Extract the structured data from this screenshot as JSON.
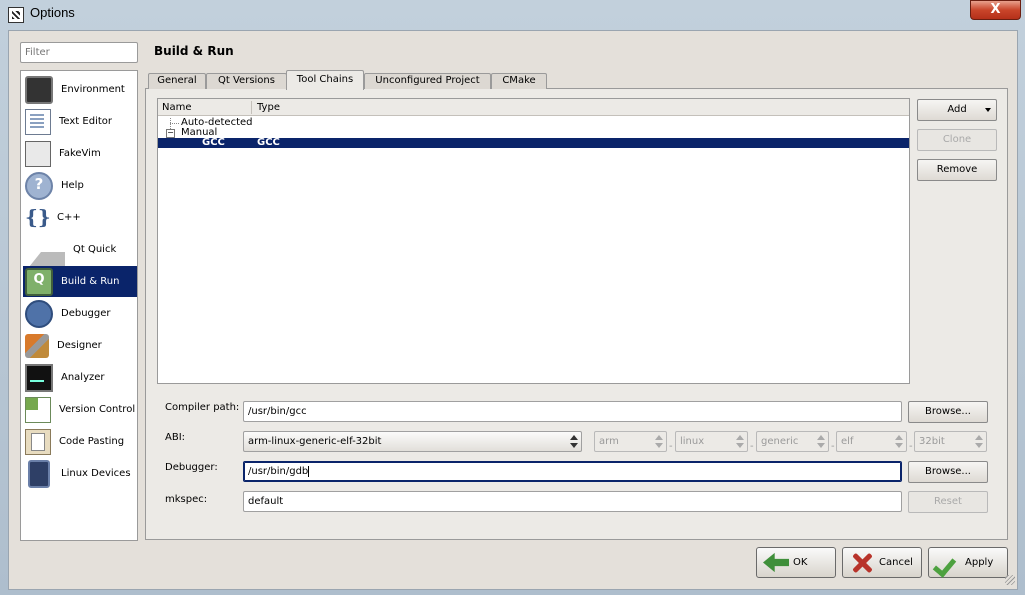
{
  "window": {
    "title": "Options",
    "close_label": "X"
  },
  "filter": {
    "placeholder": "Filter"
  },
  "categories": [
    {
      "label": "Environment",
      "icon": "monitor-icon"
    },
    {
      "label": "Text Editor",
      "icon": "document-icon"
    },
    {
      "label": "FakeVim",
      "icon": "fakevim-icon"
    },
    {
      "label": "Help",
      "icon": "help-icon"
    },
    {
      "label": "C++",
      "icon": "braces-icon"
    },
    {
      "label": "Qt Quick",
      "icon": "paper-plane-icon"
    },
    {
      "label": "Build & Run",
      "icon": "build-run-icon",
      "selected": true
    },
    {
      "label": "Debugger",
      "icon": "bug-icon"
    },
    {
      "label": "Designer",
      "icon": "pencil-ruler-icon"
    },
    {
      "label": "Analyzer",
      "icon": "oscilloscope-icon"
    },
    {
      "label": "Version Control",
      "icon": "version-control-icon"
    },
    {
      "label": "Code Pasting",
      "icon": "clipboard-icon"
    },
    {
      "label": "Linux Devices",
      "icon": "tablet-icon"
    }
  ],
  "page": {
    "title": "Build & Run"
  },
  "tabs": [
    {
      "label": "General"
    },
    {
      "label": "Qt Versions"
    },
    {
      "label": "Tool Chains",
      "active": true
    },
    {
      "label": "Unconfigured Project"
    },
    {
      "label": "CMake"
    }
  ],
  "tree": {
    "columns": [
      "Name",
      "Type"
    ],
    "auto_detected": "Auto-detected",
    "manual": "Manual",
    "selected_row": {
      "name": "GCC",
      "type": "GCC"
    }
  },
  "side_buttons": {
    "add": "Add",
    "clone": "Clone",
    "remove": "Remove"
  },
  "form": {
    "compiler_path_label": "Compiler path:",
    "compiler_path": "/usr/bin/gcc",
    "abi_label": "ABI:",
    "abi_value": "arm-linux-generic-elf-32bit",
    "abi_parts": [
      "arm",
      "linux",
      "generic",
      "elf",
      "32bit"
    ],
    "debugger_label": "Debugger:",
    "debugger": "/usr/bin/gdb",
    "mkspec_label": "mkspec:",
    "mkspec": "default",
    "browse": "Browse...",
    "reset": "Reset"
  },
  "dialog_buttons": {
    "ok": "OK",
    "cancel": "Cancel",
    "apply": "Apply"
  }
}
